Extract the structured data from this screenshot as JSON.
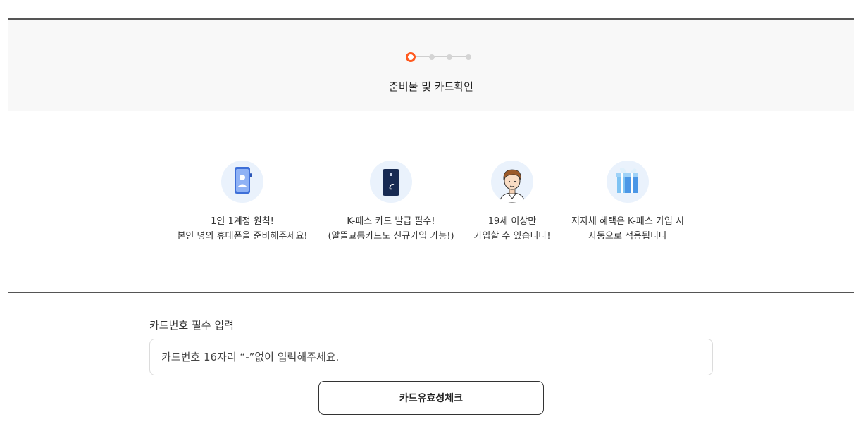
{
  "stepper": {
    "current_step": 1,
    "total_steps": 4,
    "title": "준비물 및 카드확인",
    "accent_color": "#ff5a1f"
  },
  "features": [
    {
      "icon": "smartphone-icon",
      "line1": "1인 1계정 원칙!",
      "line2": "본인 명의 휴대폰을 준비해주세요!"
    },
    {
      "icon": "transit-card-icon",
      "line1": "K-패스 카드 발급 필수!",
      "line2": "(알뜰교통카드도 신규가입 가능!)"
    },
    {
      "icon": "person-avatar-icon",
      "line1": "19세 이상만",
      "line2": "가입할 수 있습니다!"
    },
    {
      "icon": "gift-box-icon",
      "line1": "지자체 혜택은 K-패스 가입 시",
      "line2": "자동으로 적용됩니다"
    }
  ],
  "card_form": {
    "label": "카드번호 필수 입력",
    "input_placeholder": "카드번호 16자리 “-”없이 입력해주세요.",
    "input_value": "",
    "check_button_label": "카드유효성체크"
  }
}
